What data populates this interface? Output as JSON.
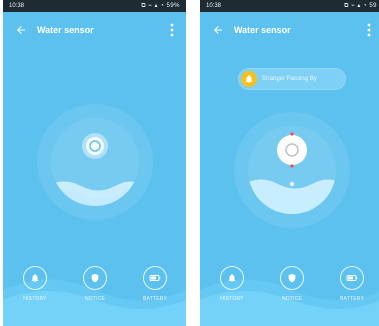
{
  "screens": [
    {
      "status": {
        "time": "10:38",
        "icons": "⧉ ⌁ ▴ ◔ 59%"
      },
      "appbar": {
        "title": "Water sensor"
      },
      "nav": [
        {
          "label": "HISTORY",
          "icon": "bell-icon"
        },
        {
          "label": "NOTICE",
          "icon": "shield-icon"
        },
        {
          "label": "BATTERY",
          "icon": "battery-icon"
        }
      ]
    },
    {
      "status": {
        "time": "10:38",
        "icons": "⧉ ⌁ ▴ ◔ 59"
      },
      "appbar": {
        "title": "Water sensor"
      },
      "banner": {
        "text": "Stranger Passing By"
      },
      "nav": [
        {
          "label": "HISTORY",
          "icon": "bell-icon"
        },
        {
          "label": "NOTICE",
          "icon": "shield-icon"
        },
        {
          "label": "BATTERY",
          "icon": "battery-icon"
        }
      ]
    }
  ],
  "colors": {
    "background": "#5cc1ef",
    "statusbar": "#1f2b33",
    "banner_bg": "#7fd0f5",
    "banner_icon": "#f5c21d"
  }
}
